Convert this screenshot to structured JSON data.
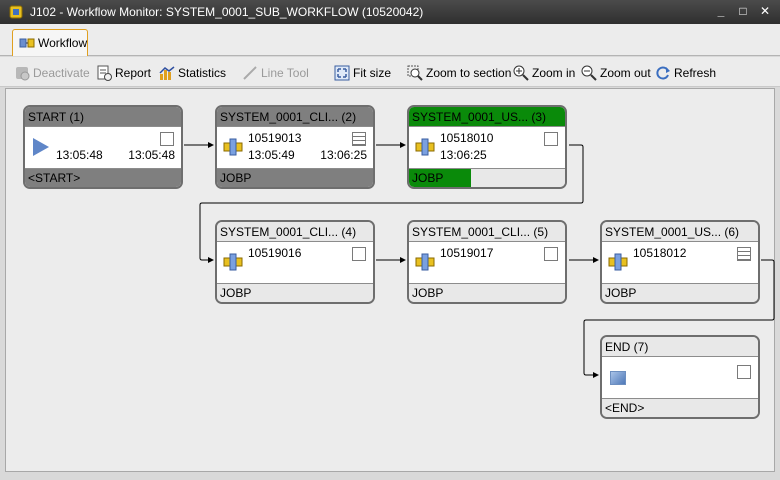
{
  "window": {
    "title": "J102 - Workflow Monitor: SYSTEM_0001_SUB_WORKFLOW (10520042)",
    "controls": {
      "minimize": "_",
      "maximize": "□",
      "close": "✕"
    }
  },
  "tab": {
    "label": "Workflow",
    "icon": "workflow-icon"
  },
  "toolbar": {
    "deactivate": "Deactivate",
    "report": "Report",
    "statistics": "Statistics",
    "line_tool": "Line Tool",
    "fit_size": "Fit size",
    "zoom_section": "Zoom to section",
    "zoom_in": "Zoom in",
    "zoom_out": "Zoom out",
    "refresh": "Refresh"
  },
  "nodes": {
    "start": {
      "title": "START (1)",
      "time_start": "13:05:48",
      "time_end": "13:05:48",
      "foot": "<START>"
    },
    "n2": {
      "title": "SYSTEM_0001_CLI... (2)",
      "job": "10519013",
      "time_start": "13:05:49",
      "time_end": "13:06:25",
      "foot": "JOBP"
    },
    "n3": {
      "title": "SYSTEM_0001_US... (3)",
      "job": "10518010",
      "time_start": "13:06:25",
      "foot": "JOBP",
      "progress": 0.4
    },
    "n4": {
      "title": "SYSTEM_0001_CLI... (4)",
      "job": "10519016",
      "foot": "JOBP"
    },
    "n5": {
      "title": "SYSTEM_0001_CLI... (5)",
      "job": "10519017",
      "foot": "JOBP"
    },
    "n6": {
      "title": "SYSTEM_0001_US... (6)",
      "job": "10518012",
      "foot": "JOBP"
    },
    "end": {
      "title": "END (7)",
      "foot": "<END>"
    }
  },
  "colors": {
    "running": "#0a8a0a",
    "finished": "#7f7f7f",
    "pending": "#e8e8e8"
  }
}
